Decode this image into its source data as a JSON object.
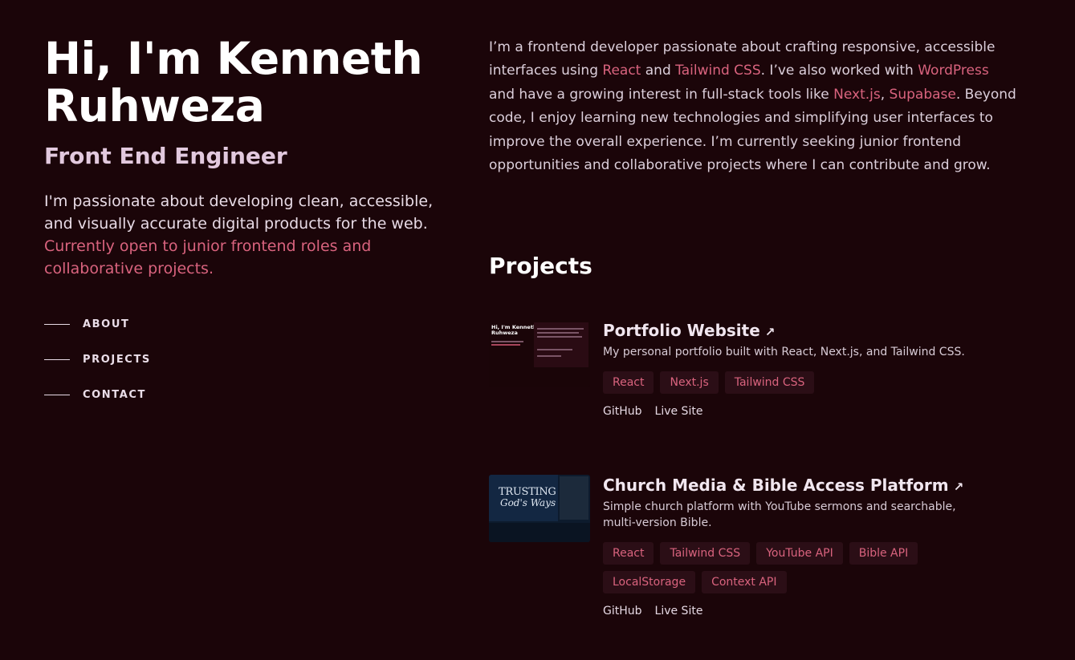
{
  "hero": {
    "name": "Hi, I'm Kenneth Ruhweza",
    "role": "Front End Engineer",
    "intro_plain": "I'm passionate about developing clean, accessible, and visually accurate digital products for the web.",
    "intro_accent": "Currently open to junior frontend roles and collaborative projects."
  },
  "nav": {
    "items": [
      {
        "label": "ABOUT"
      },
      {
        "label": "PROJECTS"
      },
      {
        "label": "CONTACT"
      }
    ]
  },
  "about": {
    "t1": "I’m a frontend developer passionate about crafting responsive, accessible interfaces using ",
    "h1": "React",
    "t2": " and ",
    "h2": "Tailwind CSS",
    "t3": ". I’ve also worked with ",
    "h3": "WordPress",
    "t4": " and have a growing interest in full-stack tools like ",
    "h4": "Next.js",
    "t5": ", ",
    "h5": "Supabase",
    "t6": ". Beyond code, I enjoy learning new technologies and simplifying user interfaces to improve the overall experience. I’m currently seeking junior frontend opportunities and collaborative projects where I can contribute and grow."
  },
  "projects": {
    "heading": "Projects",
    "items": [
      {
        "title": "Portfolio Website",
        "description": "My personal portfolio built with React, Next.js, and Tailwind CSS.",
        "tags": [
          "React",
          "Next.js",
          "Tailwind CSS"
        ],
        "links": [
          "GitHub",
          "Live Site"
        ],
        "thumb_text": "Hi, I'm Kenneth Ruhweza"
      },
      {
        "title": "Church Media & Bible Access Platform",
        "description": "Simple church platform with YouTube sermons and searchable, multi-version Bible.",
        "tags": [
          "React",
          "Tailwind CSS",
          "YouTube API",
          "Bible API",
          "LocalStorage",
          "Context API"
        ],
        "links": [
          "GitHub",
          "Live Site"
        ],
        "thumb_text_1": "TRUSTING",
        "thumb_text_2": "God's Ways"
      }
    ]
  },
  "colors": {
    "background": "#1b0509",
    "accent": "#d9637e",
    "tag_background": "#2b0e16"
  },
  "icons": {
    "project_link": "arrow-up-right-icon",
    "nav_marker": "horizontal-line"
  }
}
